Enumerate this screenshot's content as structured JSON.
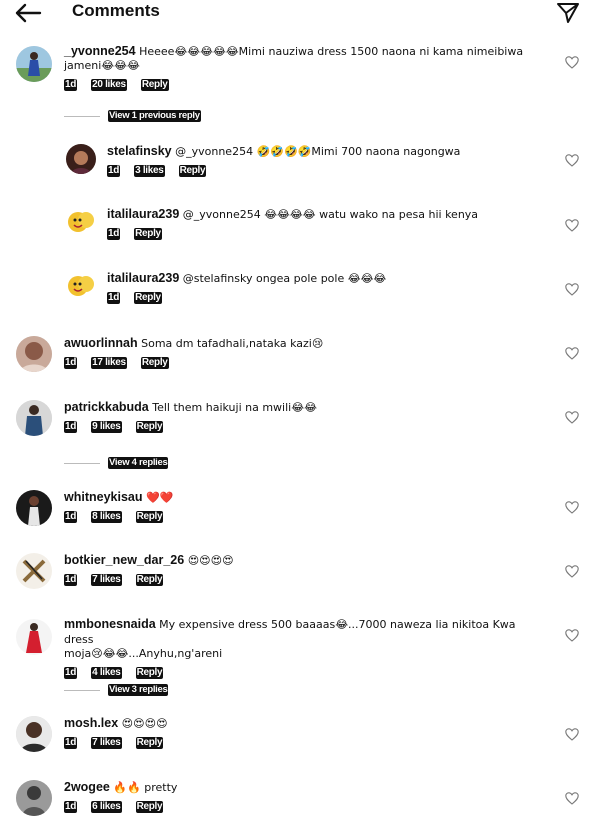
{
  "header": {
    "title": "Comments"
  },
  "view_replies": {
    "one": "View 1 previous reply",
    "four": "View 4 replies",
    "three": "View 3 replies"
  },
  "comments": [
    {
      "user": "_yvonne254",
      "text": "Heeee😂😂😂😂😂Mimi nauziwa dress 1500 naona ni kama nimeibiwa",
      "text2": "jameni😂😂😂",
      "time": "1d",
      "likes": "20 likes",
      "reply": "Reply"
    },
    {
      "user": "stelafinsky",
      "text": "@_yvonne254 🤣🤣🤣🤣Mimi 700 naona nagongwa",
      "time": "1d",
      "likes": "3 likes",
      "reply": "Reply"
    },
    {
      "user": "italilaura239",
      "text": "@_yvonne254 😂😂😂😂 watu wako na pesa hii kenya",
      "time": "1d",
      "reply": "Reply"
    },
    {
      "user": "italilaura239",
      "text": "@stelafinsky ongea pole pole 😂😂😂",
      "time": "1d",
      "reply": "Reply"
    },
    {
      "user": "awuorlinnah",
      "text": "Soma dm tafadhali,nataka kazi😢",
      "time": "1d",
      "likes": "17 likes",
      "reply": "Reply"
    },
    {
      "user": "patrickkabuda",
      "text": "Tell them haikuji na mwili😂😂",
      "time": "1d",
      "likes": "9 likes",
      "reply": "Reply"
    },
    {
      "user": "whitneykisau",
      "text": "❤️❤️",
      "time": "1d",
      "likes": "8 likes",
      "reply": "Reply"
    },
    {
      "user": "botkier_new_dar_26",
      "text": "😍😍😍😍",
      "time": "1d",
      "likes": "7 likes",
      "reply": "Reply"
    },
    {
      "user": "mmbonesnaida",
      "text": "My expensive dress 500 baaaas😂...7000 naweza lia nikitoa Kwa dress",
      "text2": "moja😢😂😂...Anyhu,ng'areni",
      "time": "1d",
      "likes": "4 likes",
      "reply": "Reply"
    },
    {
      "user": "mosh.lex",
      "text": "😍😍😍😍",
      "time": "1d",
      "likes": "7 likes",
      "reply": "Reply"
    },
    {
      "user": "2wogee",
      "text": "🔥🔥 pretty",
      "time": "1d",
      "likes": "6 likes",
      "reply": "Reply"
    }
  ]
}
